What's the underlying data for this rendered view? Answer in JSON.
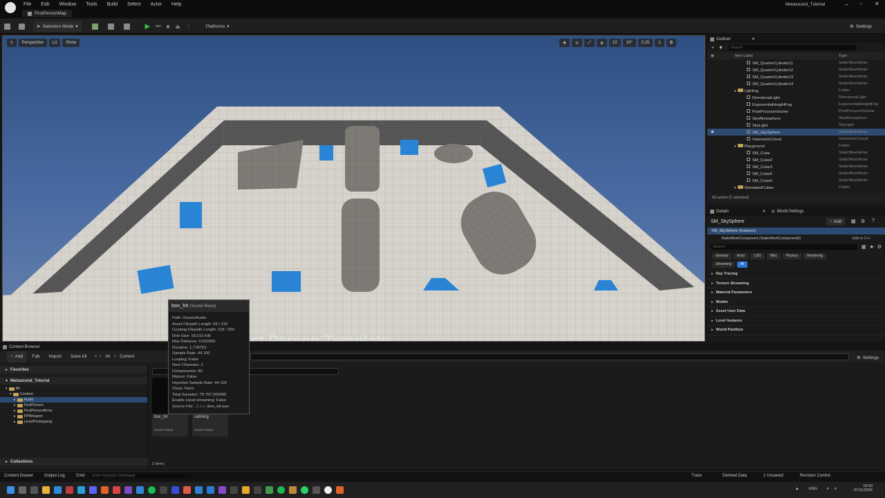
{
  "menu": [
    "File",
    "Edit",
    "Window",
    "Tools",
    "Build",
    "Select",
    "Actor",
    "Help"
  ],
  "map_tab": "FirstPersonMap",
  "project_name": "Metasound_Tutorial",
  "toolbar": {
    "selection_mode": "Selection Mode",
    "platforms": "Platforms",
    "settings": "Settings"
  },
  "viewport": {
    "perspective": "Perspective",
    "lit": "Lit",
    "show": "Show",
    "grid_snap": "10",
    "rot_snap": "10°",
    "scale_snap": "0.25",
    "cam_speed": "1",
    "floor_text": "First Person Template"
  },
  "tooltip": {
    "title": "box_hit",
    "type": "(Sound Wave)",
    "lines": [
      "Path: /Game/Audio",
      "Asset Filepath Length: 69 / 210",
      "Cooking Filepath Length: 118 / 260",
      "Disk Size: 18,215 KiB",
      "Max Distance: 0,000000",
      "Duration: 1,718753",
      "Sample Rate: 44 100",
      "Looping: False",
      "Num Channels: 2",
      "Compression: 80",
      "Mature: False",
      "Imported Sample Rate: 44 100",
      "Class: None",
      "Total Samples: 75 797,000000",
      "Enable cloud streaming: False",
      "Source File: ../../../../box_hit.wav"
    ]
  },
  "content_browser": {
    "tab": "Content Browser",
    "add": "Add",
    "fab": "Fab",
    "import": "Import",
    "save_all": "Save All",
    "crumb_all": "All",
    "crumb_content": "Content",
    "settings": "Settings",
    "favorites": "Favorites",
    "project": "Metasound_Tutorial",
    "collections": "Collections",
    "tree": [
      {
        "label": "All",
        "depth": 0
      },
      {
        "label": "Content",
        "depth": 1
      },
      {
        "label": "Audio",
        "depth": 2,
        "selected": true
      },
      {
        "label": "FirstPerson",
        "depth": 2
      },
      {
        "label": "FirstPersonArms",
        "depth": 2
      },
      {
        "label": "FPWeapon",
        "depth": 2
      },
      {
        "label": "LevelPrototyping",
        "depth": 2
      }
    ],
    "assets": [
      {
        "name": "box_hit",
        "type": "Sound Wave"
      },
      {
        "name": "calming",
        "type": "Sound Wave"
      }
    ],
    "item_count": "2 items"
  },
  "bottom": {
    "drawer": "Content Drawer",
    "output_log": "Output Log",
    "cmd": "Cmd",
    "console_placeholder": "Enter Console Command",
    "trace": "Trace",
    "derived": "Derived Data",
    "unsaved": "1 Unsaved",
    "revision": "Revision Control"
  },
  "outliner": {
    "tab": "Outliner",
    "search_placeholder": "Search",
    "col_label": "Item Label",
    "col_type": "Type",
    "rows": [
      {
        "label": "SM_QuarterCylinder11",
        "type": "StaticMeshActor",
        "depth": 3
      },
      {
        "label": "SM_QuarterCylinder12",
        "type": "StaticMeshActor",
        "depth": 3
      },
      {
        "label": "SM_QuarterCylinder13",
        "type": "StaticMeshActor",
        "depth": 3
      },
      {
        "label": "SM_QuarterCylinder14",
        "type": "StaticMeshActor",
        "depth": 3
      },
      {
        "label": "Lighting",
        "type": "Folder",
        "depth": 2,
        "folder": true
      },
      {
        "label": "DirectionalLight",
        "type": "DirectionalLight",
        "depth": 3
      },
      {
        "label": "ExponentialHeightFog",
        "type": "ExponentialHeightFog",
        "depth": 3
      },
      {
        "label": "PostProcessVolume",
        "type": "PostProcessVolume",
        "depth": 3
      },
      {
        "label": "SkyAtmosphere",
        "type": "SkyAtmosphere",
        "depth": 3
      },
      {
        "label": "SkyLight",
        "type": "SkyLight",
        "depth": 3
      },
      {
        "label": "SM_SkySphere",
        "type": "StaticMeshActor",
        "depth": 3,
        "selected": true
      },
      {
        "label": "VolumetricCloud",
        "type": "VolumetricCloud",
        "depth": 3
      },
      {
        "label": "Playground",
        "type": "Folder",
        "depth": 2,
        "folder": true
      },
      {
        "label": "SM_Cube",
        "type": "StaticMeshActor",
        "depth": 3
      },
      {
        "label": "SM_Cube2",
        "type": "StaticMeshActor",
        "depth": 3
      },
      {
        "label": "SM_Cube3",
        "type": "StaticMeshActor",
        "depth": 3
      },
      {
        "label": "SM_Cube5",
        "type": "StaticMeshActor",
        "depth": 3
      },
      {
        "label": "SM_Cube6",
        "type": "StaticMeshActor",
        "depth": 3
      },
      {
        "label": "SimulatedCubes",
        "type": "Folder",
        "depth": 2,
        "folder": true
      }
    ],
    "footer": "60 actors (1 selected)"
  },
  "details": {
    "tab": "Details",
    "world_settings": "World Settings",
    "actor": "SM_SkySphere",
    "add": "Add",
    "instance": "SM_SkySphere (Instance)",
    "component": "StaticMeshComponent (StaticMeshComponent0)",
    "edit_cpp": "Edit in C++",
    "search_placeholder": "Search",
    "filters_row1": [
      "General",
      "Actor",
      "LOD",
      "Misc",
      "Physics",
      "Rendering"
    ],
    "filters_row2": [
      "Streaming",
      "All"
    ],
    "categories": [
      "Ray Tracing",
      "Texture Streaming",
      "Material Parameters",
      "Mobile",
      "Asset User Data",
      "Level Instance",
      "World Partition"
    ]
  },
  "taskbar": {
    "lang": "ENG",
    "time": "18:53",
    "date": "07/11/2024"
  }
}
